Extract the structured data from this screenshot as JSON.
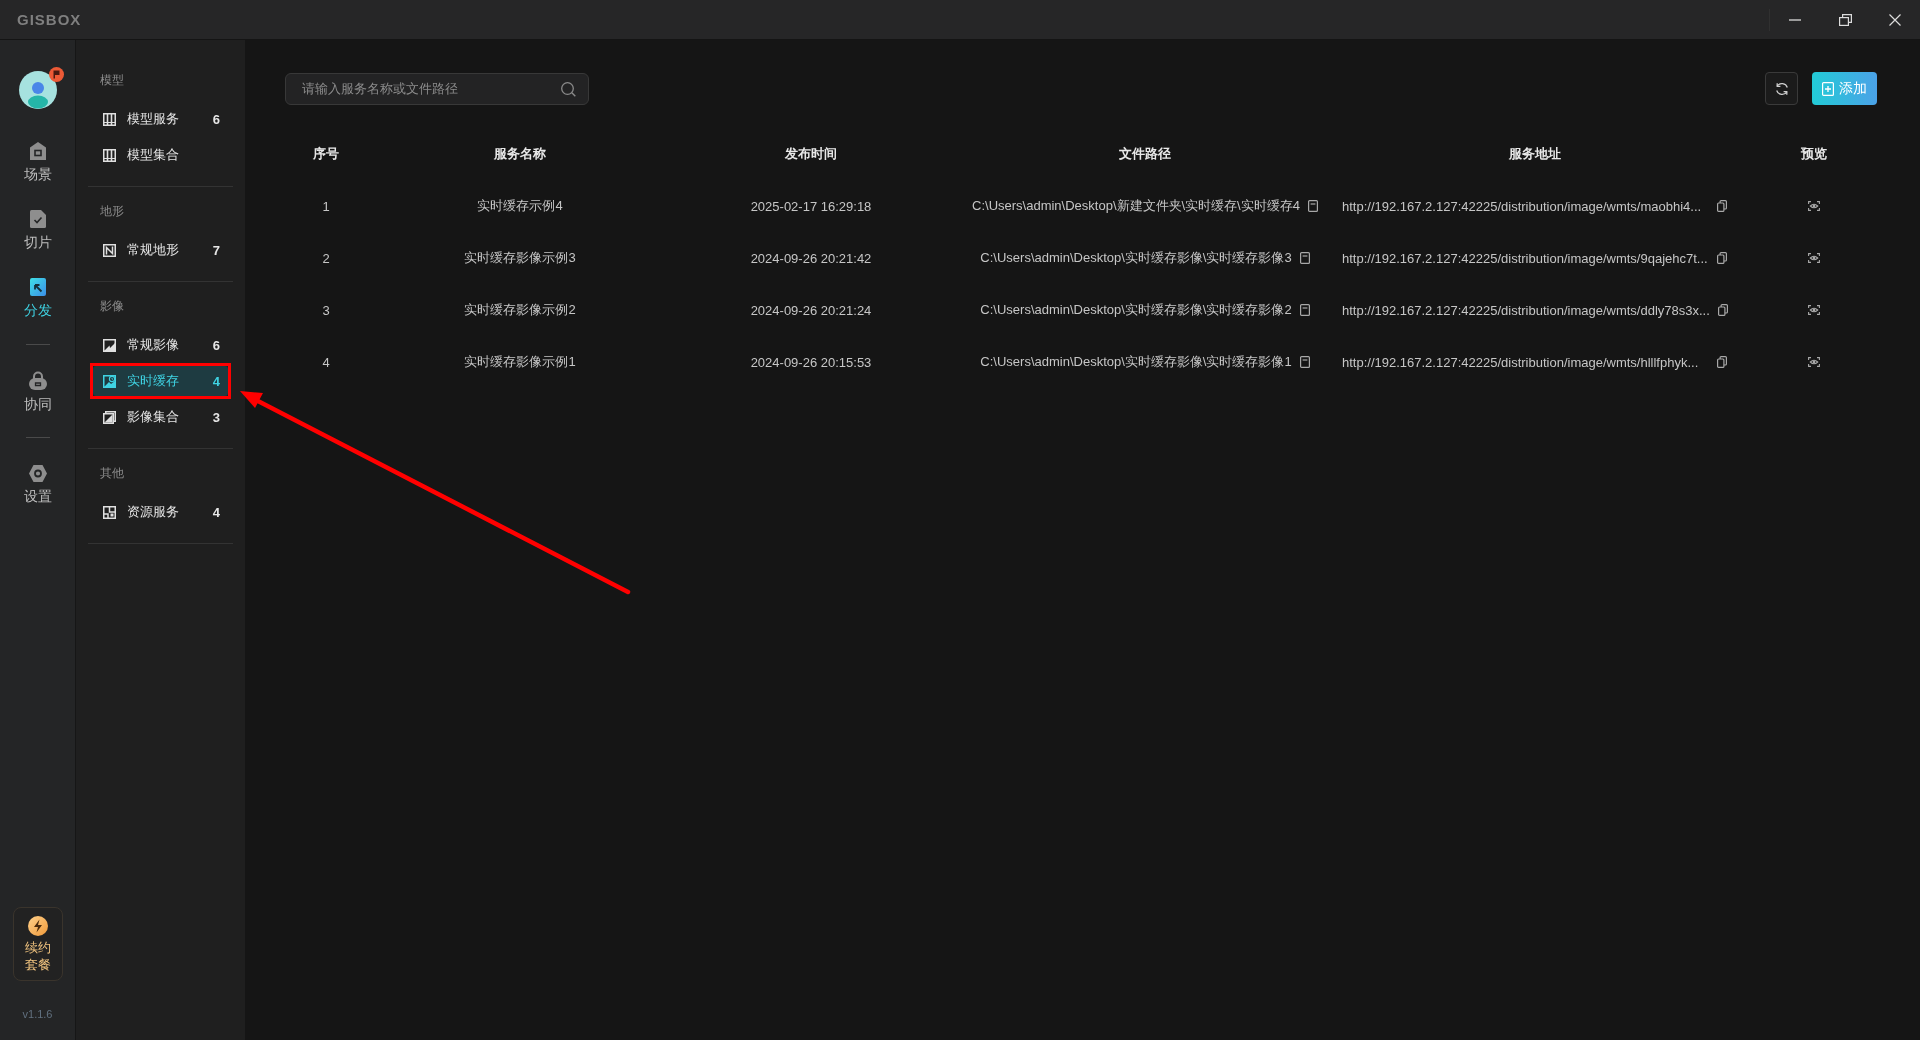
{
  "window": {
    "logo": "GISBOX"
  },
  "rail": {
    "groups": [
      {
        "items": [
          {
            "kind": "scene",
            "label": "场景",
            "selected": false
          },
          {
            "kind": "slice",
            "label": "切片",
            "selected": false
          },
          {
            "kind": "publish",
            "label": "分发",
            "selected": true
          }
        ]
      },
      {
        "items": [
          {
            "kind": "collab",
            "label": "协同",
            "selected": false
          }
        ]
      },
      {
        "items": [
          {
            "kind": "settings",
            "label": "设置",
            "selected": false
          }
        ]
      }
    ],
    "renew": "续约套餐",
    "version": "v1.1.6"
  },
  "sidebar": {
    "groups": [
      {
        "title": "模型",
        "items": [
          {
            "kind": "model",
            "label": "模型服务",
            "count": "6",
            "selected": false,
            "annotated": false
          },
          {
            "kind": "model",
            "label": "模型集合",
            "selected": false,
            "annotated": false
          }
        ]
      },
      {
        "title": "地形",
        "items": [
          {
            "kind": "terrain",
            "label": "常规地形",
            "count": "7",
            "selected": false,
            "annotated": false
          }
        ]
      },
      {
        "title": "影像",
        "items": [
          {
            "kind": "image",
            "label": "常规影像",
            "count": "6",
            "selected": false,
            "annotated": false
          },
          {
            "kind": "cache",
            "label": "实时缓存",
            "count": "4",
            "selected": true,
            "annotated": true
          },
          {
            "kind": "stack",
            "label": "影像集合",
            "count": "3",
            "selected": false,
            "annotated": false
          }
        ]
      },
      {
        "title": "其他",
        "items": [
          {
            "kind": "resource",
            "label": "资源服务",
            "count": "4",
            "selected": false,
            "annotated": false
          }
        ]
      }
    ]
  },
  "toolbar": {
    "search": {
      "placeholder": "请输入服务名称或文件路径"
    },
    "add_button": "添加"
  },
  "table": {
    "columns": [
      "序号",
      "服务名称",
      "发布时间",
      "文件路径",
      "服务地址",
      "预览"
    ],
    "rows": [
      {
        "index": "1",
        "name": "实时缓存示例4",
        "time": "2025-02-17 16:29:18",
        "path": "C:\\Users\\admin\\Desktop\\新建文件夹\\实时缓存\\实时缓存4",
        "url": "http://192.167.2.127:42225/distribution/image/wmts/maobhi4..."
      },
      {
        "index": "2",
        "name": "实时缓存影像示例3",
        "time": "2024-09-26 20:21:42",
        "path": "C:\\Users\\admin\\Desktop\\实时缓存影像\\实时缓存影像3",
        "url": "http://192.167.2.127:42225/distribution/image/wmts/9qajehc7t..."
      },
      {
        "index": "3",
        "name": "实时缓存影像示例2",
        "time": "2024-09-26 20:21:24",
        "path": "C:\\Users\\admin\\Desktop\\实时缓存影像\\实时缓存影像2",
        "url": "http://192.167.2.127:42225/distribution/image/wmts/ddly78s3x..."
      },
      {
        "index": "4",
        "name": "实时缓存影像示例1",
        "time": "2024-09-26 20:15:53",
        "path": "C:\\Users\\admin\\Desktop\\实时缓存影像\\实时缓存影像1",
        "url": "http://192.167.2.127:42225/distribution/image/wmts/hlllfphyk..."
      }
    ]
  }
}
